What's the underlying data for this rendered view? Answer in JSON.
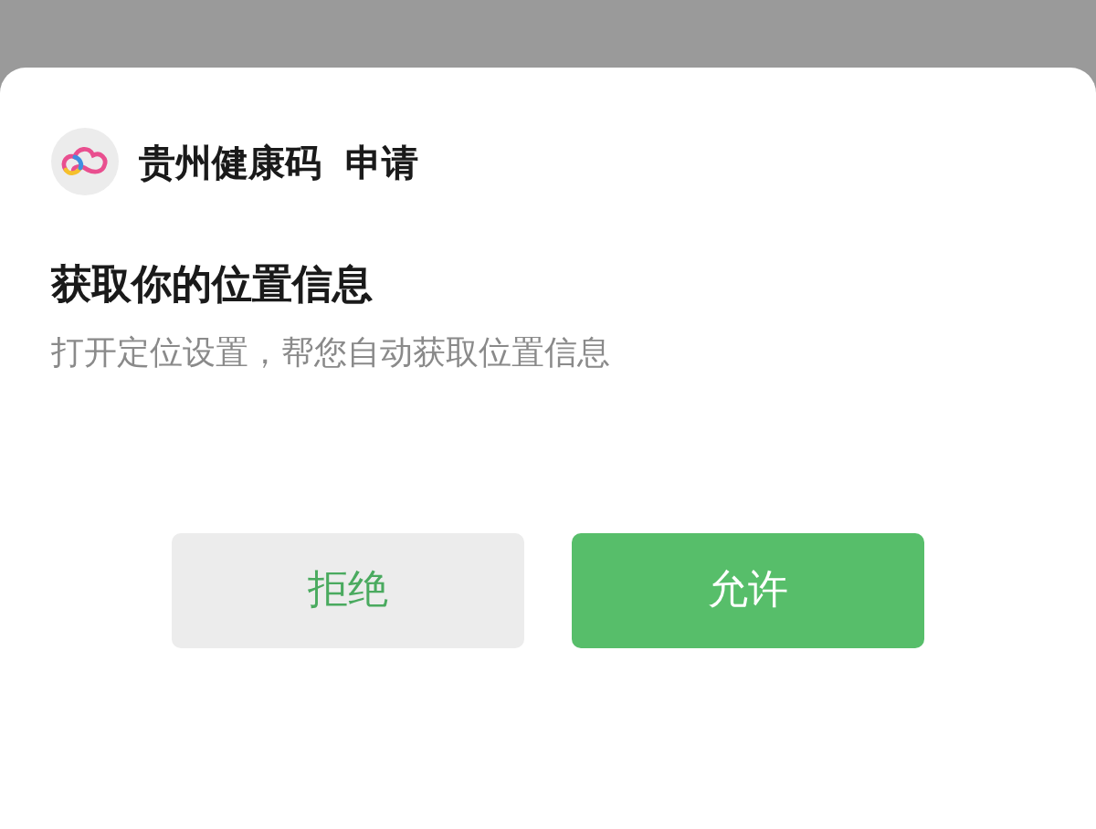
{
  "app": {
    "name": "贵州健康码",
    "action": "申请"
  },
  "dialog": {
    "title": "获取你的位置信息",
    "message": "打开定位设置，帮您自动获取位置信息"
  },
  "buttons": [
    {
      "label": "拒绝",
      "kind": "secondary"
    },
    {
      "label": "允许",
      "kind": "primary"
    }
  ]
}
